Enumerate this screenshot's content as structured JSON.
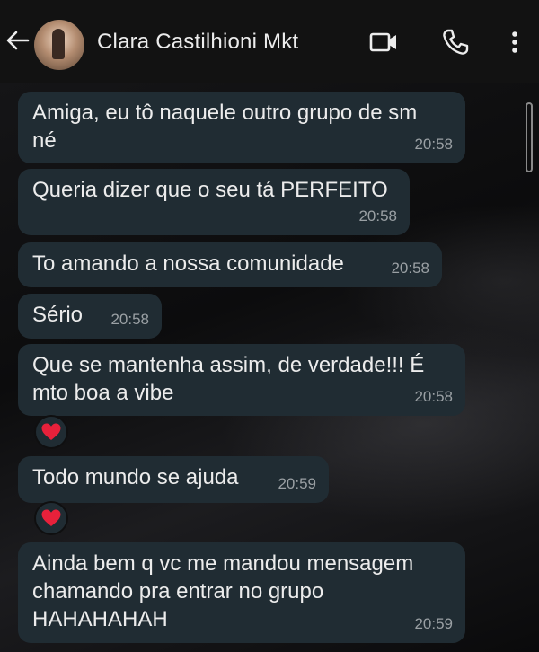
{
  "header": {
    "contact_name": "Clara Castilhioni Mkt",
    "icons": [
      "back-arrow-icon",
      "video-call-icon",
      "voice-call-icon",
      "more-options-icon"
    ]
  },
  "messages": [
    {
      "text": "Amiga, eu tô naquele outro grupo de sm\nné",
      "time": "20:58",
      "reaction": null
    },
    {
      "text": "Queria dizer que o seu tá PERFEITO",
      "time": "20:58",
      "reaction": null
    },
    {
      "text": "To amando a nossa comunidade",
      "time": "20:58",
      "reaction": null
    },
    {
      "text": "Sério",
      "time": "20:58",
      "reaction": null
    },
    {
      "text": "Que se mantenha assim, de verdade!!! É\nmto boa a vibe",
      "time": "20:58",
      "reaction": "heart"
    },
    {
      "text": "Todo mundo se ajuda",
      "time": "20:59",
      "reaction": "heart"
    },
    {
      "text": "Ainda bem q vc me mandou mensagem\nchamando pra entrar no grupo\nHAHAHAHAH",
      "time": "20:59",
      "reaction": null
    }
  ],
  "colors": {
    "header_bg": "#121212",
    "bubble_bg": "#202c33",
    "text": "#ececec",
    "timestamp": "#9aa0a4",
    "reaction_heart": "#e8213b"
  }
}
